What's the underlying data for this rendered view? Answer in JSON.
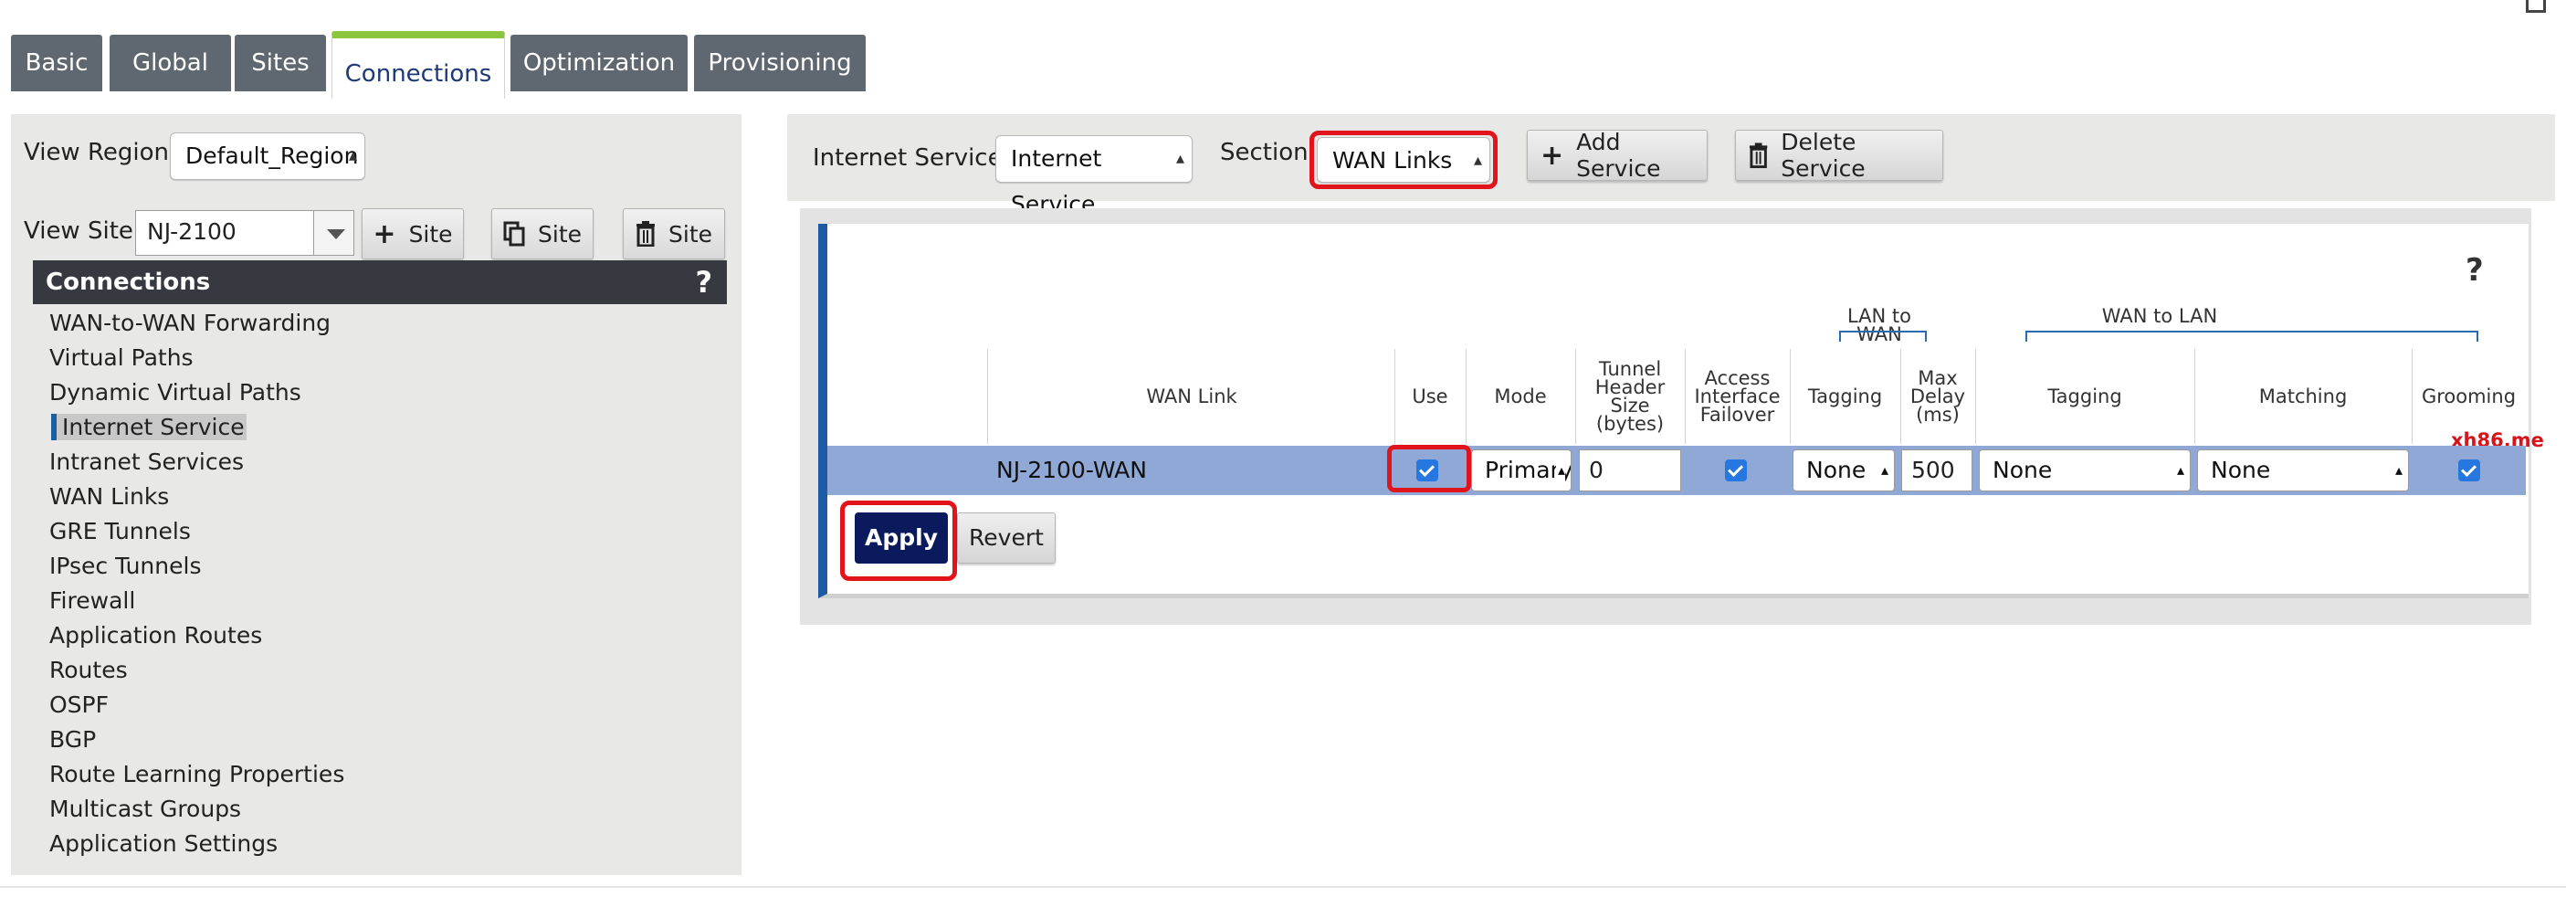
{
  "tabs": [
    "Basic",
    "Global",
    "Sites",
    "Connections",
    "Optimization",
    "Provisioning"
  ],
  "left": {
    "view_region_label": "View Region:",
    "view_region_value": "Default_Region",
    "view_site_label": "View Site:",
    "view_site_value": "NJ-2100",
    "site_buttons": [
      "Site",
      "Site",
      "Site"
    ],
    "connections_title": "Connections",
    "help": "?",
    "menu": [
      "WAN-to-WAN Forwarding",
      "Virtual Paths",
      "Dynamic Virtual Paths",
      "Internet Service",
      "Intranet Services",
      "WAN Links",
      "GRE Tunnels",
      "IPsec Tunnels",
      "Firewall",
      "Application Routes",
      "Routes",
      "OSPF",
      "BGP",
      "Route Learning Properties",
      "Multicast Groups",
      "Application Settings"
    ],
    "selected_item": "Internet Service"
  },
  "toolbar": {
    "internet_service_label": "Internet Service:",
    "internet_service_value": "Internet Service",
    "section_label": "Section:",
    "section_value": "WAN Links",
    "add_service": "Add Service",
    "delete_service": "Delete Service"
  },
  "table": {
    "help": "?",
    "group_lan_to_wan": "LAN to WAN",
    "group_wan_to_lan": "WAN to LAN",
    "headers": {
      "wan_link": "WAN Link",
      "use": "Use",
      "mode": "Mode",
      "tunnel_header": [
        "Tunnel",
        "Header",
        "Size",
        "(bytes)"
      ],
      "access_failover": [
        "Access",
        "Interface",
        "Failover"
      ],
      "tagging_lan": "Tagging",
      "max_delay": [
        "Max",
        "Delay",
        "(ms)"
      ],
      "tagging_wan": "Tagging",
      "matching": "Matching",
      "grooming": "Grooming"
    },
    "row": {
      "wan_link": "NJ-2100-WAN",
      "use": true,
      "mode": "Primary",
      "tunnel_header_size": "0",
      "access_failover": true,
      "tagging_lan": "None",
      "max_delay": "500",
      "tagging_wan": "None",
      "matching": "None",
      "grooming": true
    }
  },
  "actions": {
    "apply": "Apply",
    "revert": "Revert"
  },
  "watermark": "xh86.me",
  "colors": {
    "accent_tab": "#8cc63f",
    "tab_bg": "#5f6870",
    "highlight": "#e0141a",
    "row_bg": "#8fa8d5",
    "apply_bg": "#0a1a5c",
    "checkbox": "#2677e0"
  }
}
